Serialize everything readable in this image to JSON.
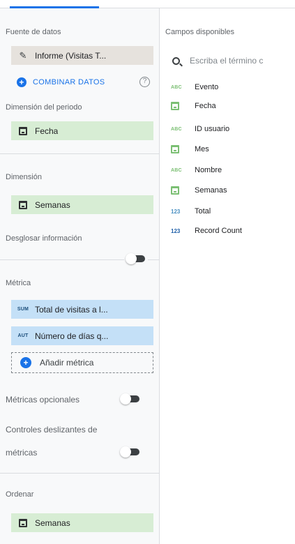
{
  "colors": {
    "accent": "#1a73e8",
    "dimension_chip": "#d7edd4",
    "metric_chip": "#c4e0f7",
    "source_chip": "#e6e2dd",
    "dimension_icon": "#7bbf73",
    "metric_icon": "#4a90c2"
  },
  "data_source": {
    "heading": "Fuente de datos",
    "name": "Informe (Visitas T...",
    "icon": "pencil-icon",
    "combine_label": "COMBINAR DATOS",
    "help_icon": "help-icon"
  },
  "date_range_dimension": {
    "heading": "Dimensión del periodo",
    "field": "Fecha",
    "icon": "calendar-icon"
  },
  "dimension": {
    "heading": "Dimensión",
    "field": "Semanas",
    "icon": "calendar-icon"
  },
  "drill_down": {
    "label": "Desglosar información",
    "enabled": false
  },
  "metric": {
    "heading": "Métrica",
    "items": [
      {
        "badge": "SUM",
        "label": "Total de visitas a l..."
      },
      {
        "badge": "AUT",
        "label": "Número de días q..."
      }
    ],
    "add_label": "Añadir métrica"
  },
  "optional_metrics": {
    "label": "Métricas opcionales",
    "enabled": false
  },
  "metric_sliders": {
    "label_line1": "Controles deslizantes de",
    "label_line2": "métricas",
    "enabled": false
  },
  "sort": {
    "heading": "Ordenar",
    "field": "Semanas",
    "icon": "calendar-icon"
  },
  "available_fields": {
    "heading": "Campos disponibles",
    "search_placeholder": "Escriba el término c",
    "fields": [
      {
        "type": "ABC",
        "label": "Evento"
      },
      {
        "type": "date",
        "label": "Fecha"
      },
      {
        "type": "ABC",
        "label": "ID usuario"
      },
      {
        "type": "date",
        "label": "Mes"
      },
      {
        "type": "ABC",
        "label": "Nombre"
      },
      {
        "type": "date",
        "label": "Semanas"
      },
      {
        "type": "123",
        "label": "Total"
      },
      {
        "type": "123",
        "label": "Record Count"
      }
    ]
  }
}
